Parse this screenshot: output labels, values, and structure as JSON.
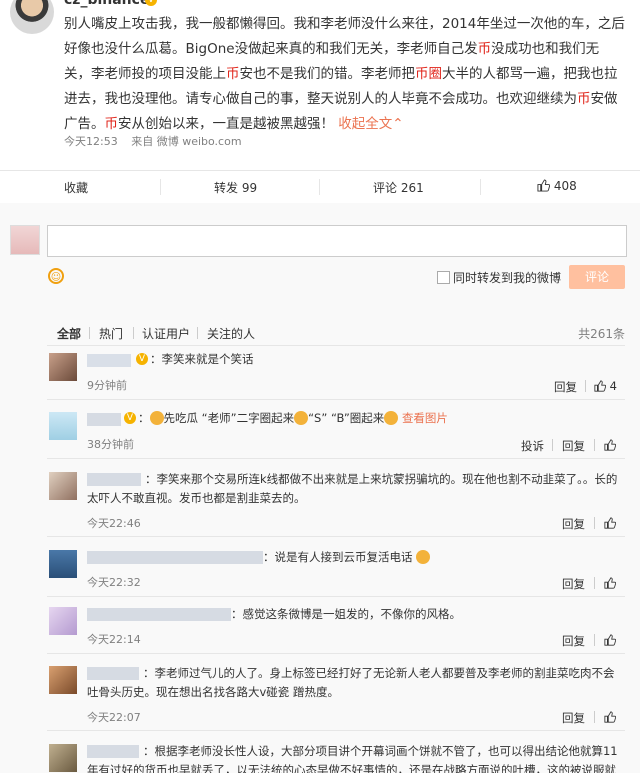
{
  "post": {
    "username": "cz_binance",
    "verified_badge": "V",
    "text_parts": [
      {
        "t": "别人嘴皮上攻击我，我一般都懒得回。我和李老师没什么来往，2014年坐过一次他的车，之后好像也没什么瓜葛。BigOne没做起来真的和我们无关，李老师自己发",
        "c": ""
      },
      {
        "t": "币",
        "c": "red"
      },
      {
        "t": "没成功也和我们无关，李老师投的项目没能上",
        "c": ""
      },
      {
        "t": "币",
        "c": "red"
      },
      {
        "t": "安也不是我们的错。李老师把",
        "c": ""
      },
      {
        "t": "币圈",
        "c": "red"
      },
      {
        "t": "大半的人都骂一遍，把我也拉进去，我也没理他。请专心做自己的事，整天说别人的人毕竟不会成功。也欢迎继续为",
        "c": ""
      },
      {
        "t": "币",
        "c": "red"
      },
      {
        "t": "安做广告。",
        "c": ""
      },
      {
        "t": "币",
        "c": "red"
      },
      {
        "t": "安从创始以来，一直是越被黑越强！",
        "c": ""
      },
      {
        "t": " 收起全文",
        "c": "link"
      },
      {
        "t": "⌃",
        "c": "link"
      }
    ],
    "time": "今天12:53",
    "source_prefix": "来自",
    "source": "微博 weibo.com"
  },
  "actions": {
    "favorite": "收藏",
    "repost": "转发 99",
    "comment": "评论 261",
    "like_icon": "thumb-up-icon",
    "like_count": "408"
  },
  "composer": {
    "emoji_icon": "smile-icon",
    "repost_checkbox_label": "同时转发到我的微博",
    "submit_label": "评论"
  },
  "filters": {
    "tabs": [
      "全部",
      "热门",
      "认证用户",
      "关注的人"
    ],
    "total": "共261条"
  },
  "comments": [
    {
      "text": "：李笑来就是个笑话",
      "time": "9分钟前",
      "reply": "回复",
      "likes": "4",
      "report": ""
    },
    {
      "text_a": "：",
      "text_b": "先吃瓜 “老师”二字圈起来",
      "text_c": "“S” “B”圈起来",
      "link": "查看图片",
      "time": "38分钟前",
      "reply": "回复",
      "report": "投诉"
    },
    {
      "text": "：李笑来那个交易所连k线都做不出来就是上来坑蒙拐骗坑的。现在他也割不动韭菜了。。长的太吓人不敢直视。发币也都是割韭菜去的。",
      "time": "今天22:46",
      "reply": "回复",
      "report": ""
    },
    {
      "text": "：说是有人接到云币复活电话",
      "time": "今天22:32",
      "reply": "回复",
      "report": ""
    },
    {
      "text": "：感觉这条微博是一姐发的，不像你的风格。",
      "time": "今天22:14",
      "reply": "回复",
      "report": ""
    },
    {
      "text": "：李老师过气儿的人了。身上标签已经打好了无论新人老人都要普及李老师的割韭菜吃肉不会吐骨头历史。现在想出名找各路大v碰瓷 蹭热度。",
      "time": "今天22:07",
      "reply": "回复",
      "report": ""
    },
    {
      "text": "：根据李老师没长性人设，大部分项目讲个开幕词画个饼就不管了，也可以得出结论他就算11年有过好的货币也早就丢了，以无法统的心态早做不好事情的，还是在战略方面说的吐槽，这的被说服就算..",
      "time": "",
      "reply": "",
      "report": ""
    }
  ]
}
